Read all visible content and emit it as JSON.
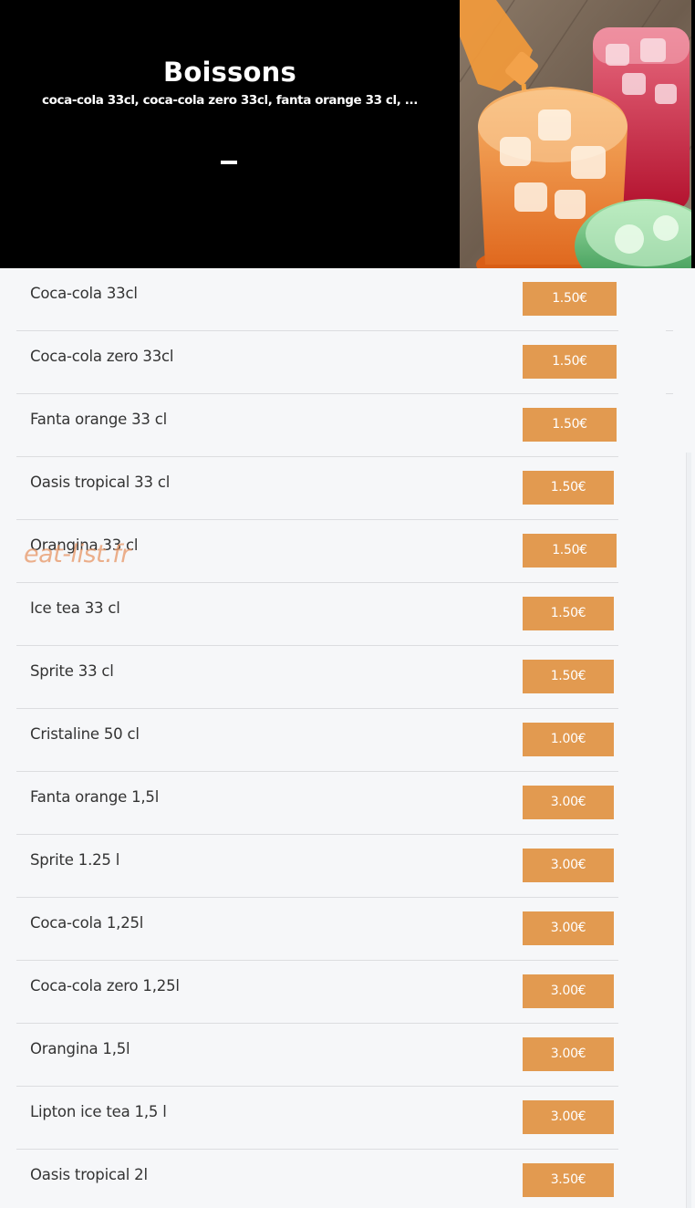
{
  "header": {
    "title": "Boissons",
    "subtitle": "coca-cola 33cl, coca-cola zero 33cl, fanta orange 33 cl, ...",
    "dash": "–"
  },
  "watermark": "eat-list.fr",
  "colors": {
    "price_bg": "#e29a50",
    "header_bg": "#000000",
    "page_bg": "#f6f7f9"
  },
  "items": [
    {
      "name": "Coca-cola 33cl",
      "price": "1.50€"
    },
    {
      "name": "Coca-cola zero 33cl",
      "price": "1.50€"
    },
    {
      "name": "Fanta orange 33 cl",
      "price": "1.50€"
    },
    {
      "name": "Oasis tropical 33 cl",
      "price": "1.50€"
    },
    {
      "name": "Orangina 33 cl",
      "price": "1.50€"
    },
    {
      "name": "Ice tea 33 cl",
      "price": "1.50€"
    },
    {
      "name": "Sprite 33 cl",
      "price": "1.50€"
    },
    {
      "name": "Cristaline 50 cl",
      "price": "1.00€"
    },
    {
      "name": "Fanta orange 1,5l",
      "price": "3.00€"
    },
    {
      "name": "Sprite 1.25 l",
      "price": "3.00€"
    },
    {
      "name": "Coca-cola 1,25l",
      "price": "3.00€"
    },
    {
      "name": "Coca-cola zero 1,25l",
      "price": "3.00€"
    },
    {
      "name": "Orangina 1,5l",
      "price": "3.00€"
    },
    {
      "name": "Lipton ice tea 1,5 l",
      "price": "3.00€"
    },
    {
      "name": "Oasis tropical 2l",
      "price": "3.50€"
    }
  ]
}
